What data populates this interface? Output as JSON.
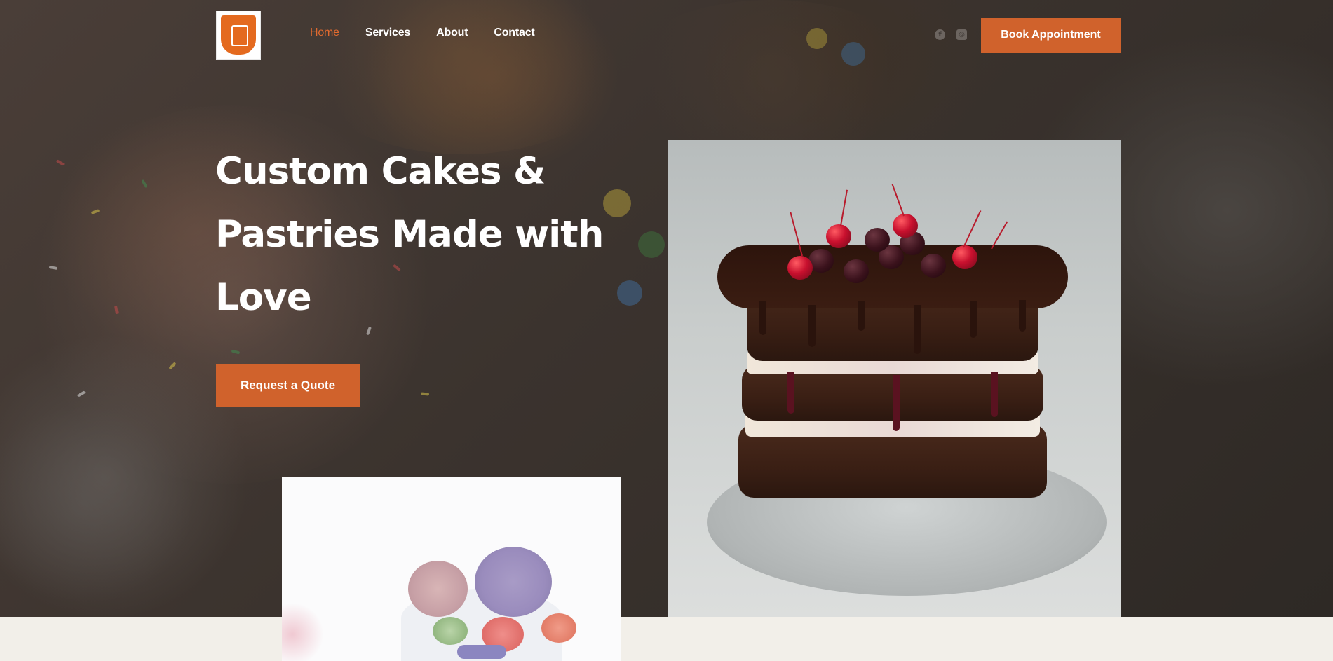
{
  "header": {
    "nav": [
      {
        "label": "Home",
        "active": true
      },
      {
        "label": "Services",
        "active": false
      },
      {
        "label": "About",
        "active": false
      },
      {
        "label": "Contact",
        "active": false
      }
    ],
    "social_icons": [
      "facebook-icon",
      "instagram-icon"
    ],
    "cta_label": "Book Appointment"
  },
  "hero": {
    "title_lines": [
      "Custom Cakes &",
      "Pastries Made with",
      "Love"
    ],
    "cta_label": "Request a Quote"
  },
  "colors": {
    "accent": "#d0622c",
    "nav_active": "#e06a2f",
    "text_light": "#ffffff",
    "section_bg": "#f2efe9"
  }
}
